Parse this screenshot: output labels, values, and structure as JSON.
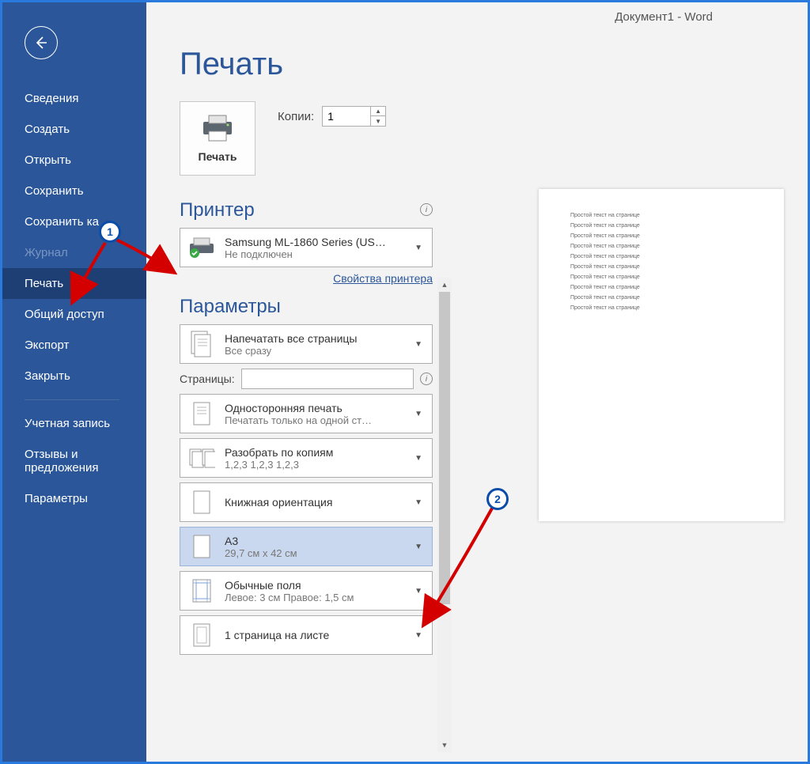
{
  "window_title": "Документ1  -  Word",
  "page_title": "Печать",
  "sidebar": {
    "items": [
      {
        "label": "Сведения",
        "state": ""
      },
      {
        "label": "Создать",
        "state": ""
      },
      {
        "label": "Открыть",
        "state": ""
      },
      {
        "label": "Сохранить",
        "state": ""
      },
      {
        "label": "Сохранить ка",
        "state": ""
      },
      {
        "label": "Журнал",
        "state": "disabled"
      },
      {
        "label": "Печать",
        "state": "selected"
      },
      {
        "label": "Общий доступ",
        "state": ""
      },
      {
        "label": "Экспорт",
        "state": ""
      },
      {
        "label": "Закрыть",
        "state": ""
      }
    ],
    "footer_items": [
      {
        "label": "Учетная запись"
      },
      {
        "label": "Отзывы и предложения"
      },
      {
        "label": "Параметры"
      }
    ]
  },
  "print_button": "Печать",
  "copies_label": "Копии:",
  "copies_value": "1",
  "printer_heading": "Принтер",
  "printer": {
    "name": "Samsung ML-1860 Series (US…",
    "status": "Не подключен"
  },
  "printer_properties": "Свойства принтера",
  "settings_heading": "Параметры",
  "settings": [
    {
      "line1": "Напечатать все страницы",
      "line2": "Все сразу"
    },
    {
      "line1": "Односторонняя печать",
      "line2": "Печатать только на одной ст…"
    },
    {
      "line1": "Разобрать по копиям",
      "line2": "1,2,3    1,2,3    1,2,3"
    },
    {
      "line1": "Книжная ориентация",
      "line2": ""
    },
    {
      "line1": "A3",
      "line2": "29,7 см x 42 см",
      "selected": true
    },
    {
      "line1": "Обычные поля",
      "line2": "Левое:  3 см    Правое:  1,5 см"
    },
    {
      "line1": "1 страница на листе",
      "line2": ""
    }
  ],
  "pages_label": "Страницы:",
  "preview_line": "Простой текст на странице",
  "badges": [
    "1",
    "2"
  ]
}
